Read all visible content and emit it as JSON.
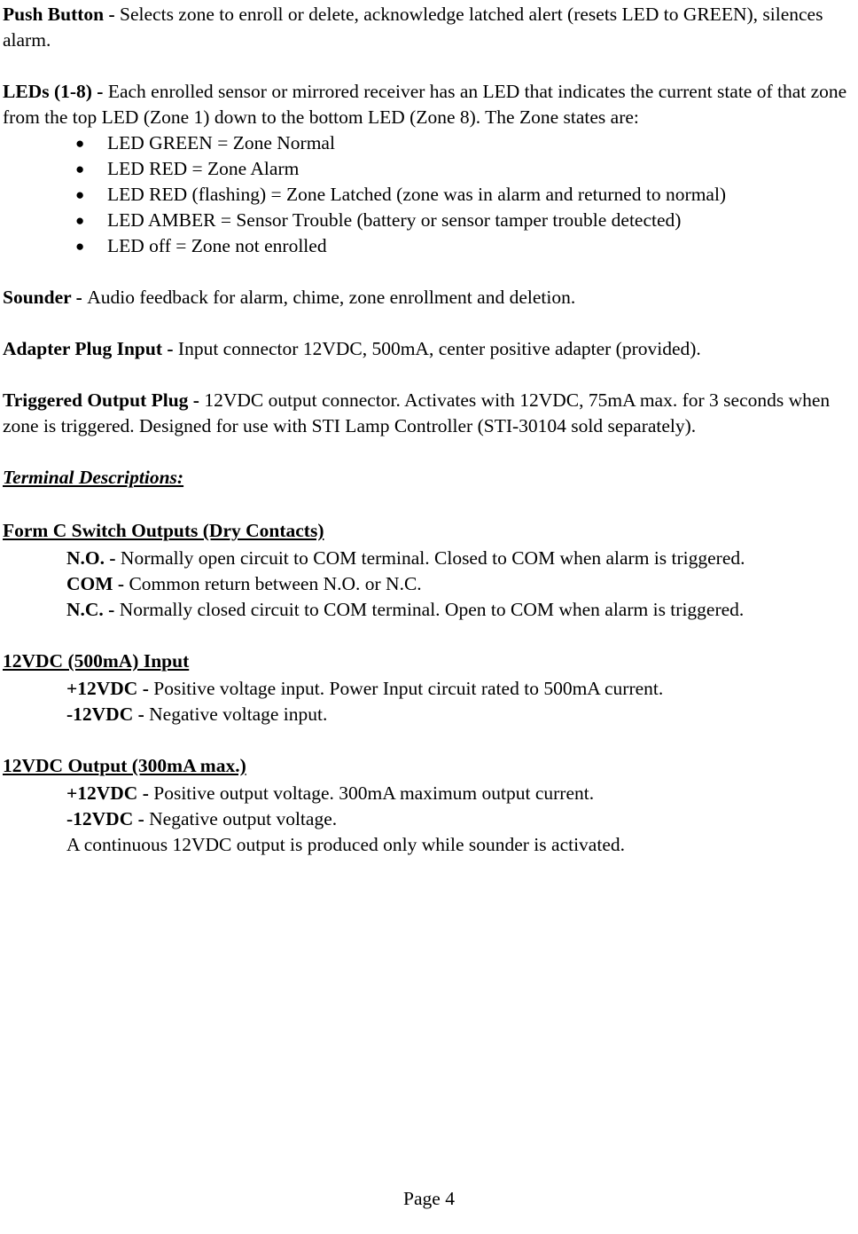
{
  "document": {
    "page_label": "Page 4",
    "sections": {
      "push_button": {
        "term": "Push Button - ",
        "text": "Selects zone to enroll or delete, acknowledge latched alert (resets LED to GREEN), silences alarm."
      },
      "leds": {
        "term": "LEDs (1-8) - ",
        "text": "Each enrolled sensor or mirrored receiver has an LED that indicates the current state of that zone from the top LED (Zone 1) down to the bottom LED (Zone 8).   The Zone states are:",
        "bullet_glyph": "●",
        "items": [
          "LED GREEN =  Zone Normal",
          "LED RED = Zone Alarm",
          "LED RED (flashing) = Zone Latched (zone was in alarm and returned to normal)",
          "LED AMBER = Sensor Trouble (battery or sensor tamper trouble detected)",
          "LED off = Zone not enrolled"
        ]
      },
      "sounder": {
        "term": "Sounder - ",
        "text": "Audio feedback for alarm, chime, zone enrollment and deletion."
      },
      "adapter_plug_input": {
        "term": "Adapter Plug Input - ",
        "text": "Input connector 12VDC, 500mA, center positive adapter (provided)."
      },
      "triggered_output_plug": {
        "term": "Triggered Output Plug - ",
        "text": "12VDC output connector.  Activates with 12VDC, 75mA max. for 3 seconds when zone is triggered.  Designed for use with STI Lamp Controller (STI-30104 sold separately)."
      },
      "terminal_descriptions": {
        "heading": "Terminal Descriptions:"
      },
      "form_c": {
        "heading": "Form C Switch Outputs (Dry Contacts)",
        "entries": [
          {
            "term": "N.O. - ",
            "text": "Normally open circuit to COM terminal.  Closed to COM when alarm is triggered."
          },
          {
            "term": "COM - ",
            "text": "Common return between N.O. or N.C."
          },
          {
            "term": "N.C. - ",
            "text": "Normally closed circuit to COM terminal. Open to COM when alarm is triggered."
          }
        ]
      },
      "input_12vdc": {
        "heading": "12VDC (500mA) Input",
        "entries": [
          {
            "term": "+12VDC - ",
            "text": "Positive voltage input.  Power Input circuit rated to 500mA current."
          },
          {
            "term": "-12VDC - ",
            "text": "Negative voltage input."
          }
        ]
      },
      "output_12vdc": {
        "heading": "12VDC Output (300mA max.)",
        "entries": [
          {
            "term": "+12VDC - ",
            "text": " Positive output voltage.  300mA maximum output current."
          },
          {
            "term": "-12VDC - ",
            "text": "Negative output voltage."
          }
        ],
        "note": "A continuous 12VDC output is produced only while sounder is activated."
      }
    }
  }
}
